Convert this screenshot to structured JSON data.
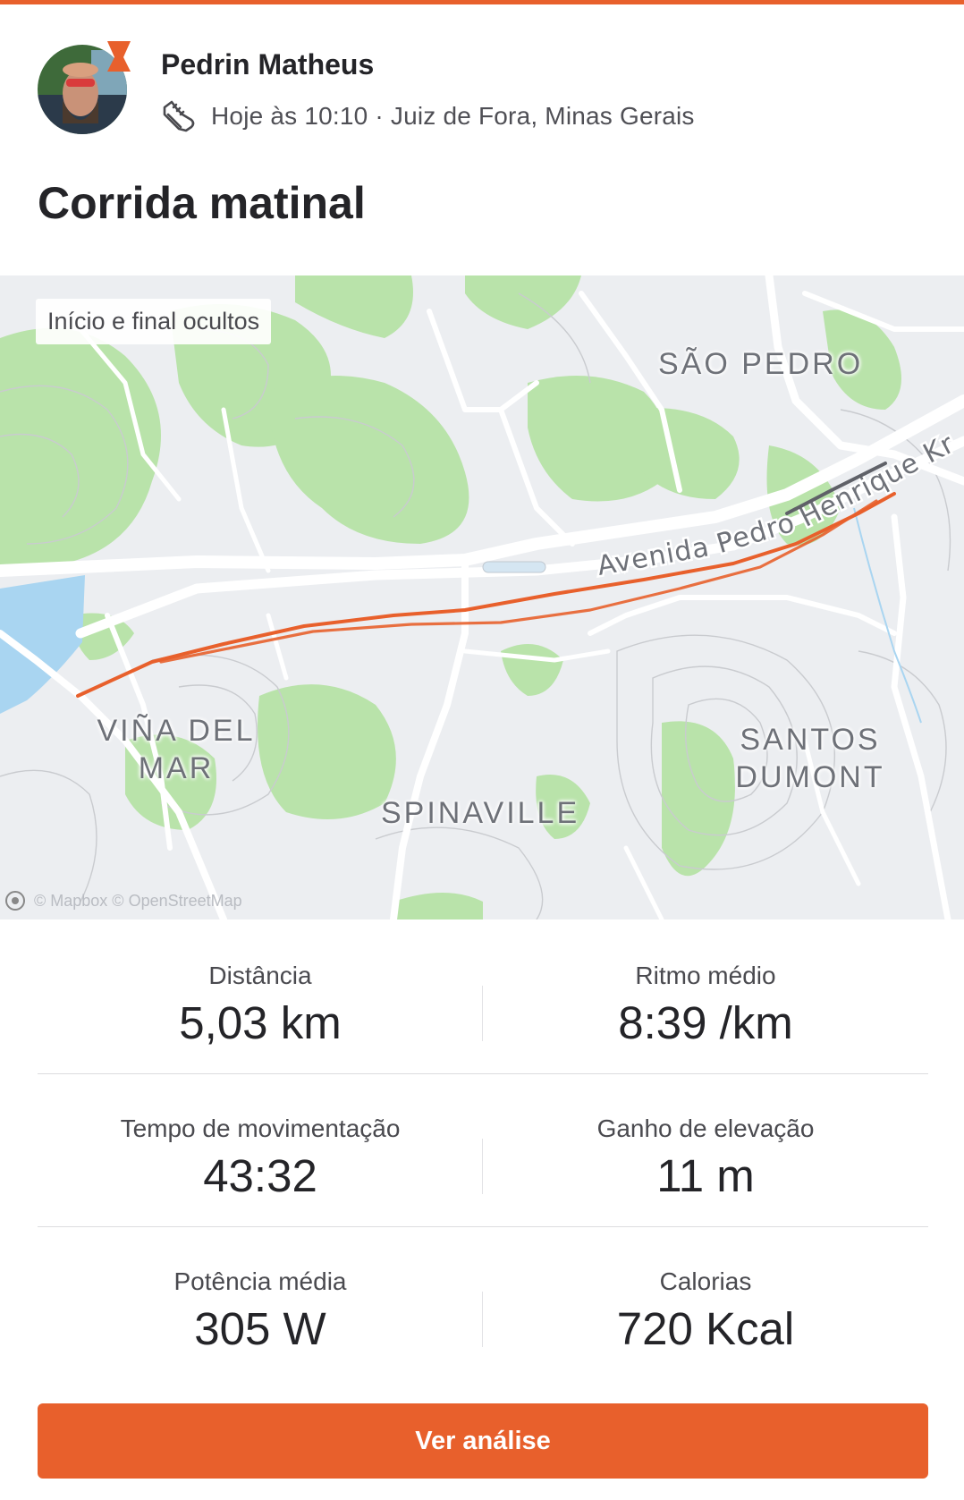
{
  "activity": {
    "athlete_name": "Pedrin Matheus",
    "meta": "Hoje às 10:10 · Juiz de Fora, Minas Gerais",
    "sport_icon": "running-shoe-icon",
    "title": "Corrida matinal"
  },
  "map": {
    "privacy_tag": "Início e final ocultos",
    "road_label": "Avenida Pedro Henrique Kramer",
    "neighborhoods": {
      "sao_pedro": "SÃO PEDRO",
      "vina_del_mar_1": "VIÑA DEL",
      "vina_del_mar_2": "MAR",
      "spinaville": "SPINAVILLE",
      "santos_dumont_1": "SANTOS",
      "santos_dumont_2": "DUMONT"
    },
    "attribution": "© Mapbox © OpenStreetMap",
    "route_color": "#e8602c"
  },
  "stats": {
    "distance": {
      "label": "Distância",
      "value": "5,03 km"
    },
    "pace": {
      "label": "Ritmo médio",
      "value": "8:39 /km"
    },
    "moving_time": {
      "label": "Tempo de movimentação",
      "value": "43:32"
    },
    "elevation": {
      "label": "Ganho de elevação",
      "value": "11 m"
    },
    "power": {
      "label": "Potência média",
      "value": "305 W"
    },
    "calories": {
      "label": "Calorias",
      "value": "720 Kcal"
    }
  },
  "cta": {
    "label": "Ver análise"
  },
  "colors": {
    "brand": "#e8602c",
    "park": "#b6e3a8",
    "water": "#a8d4f0"
  }
}
